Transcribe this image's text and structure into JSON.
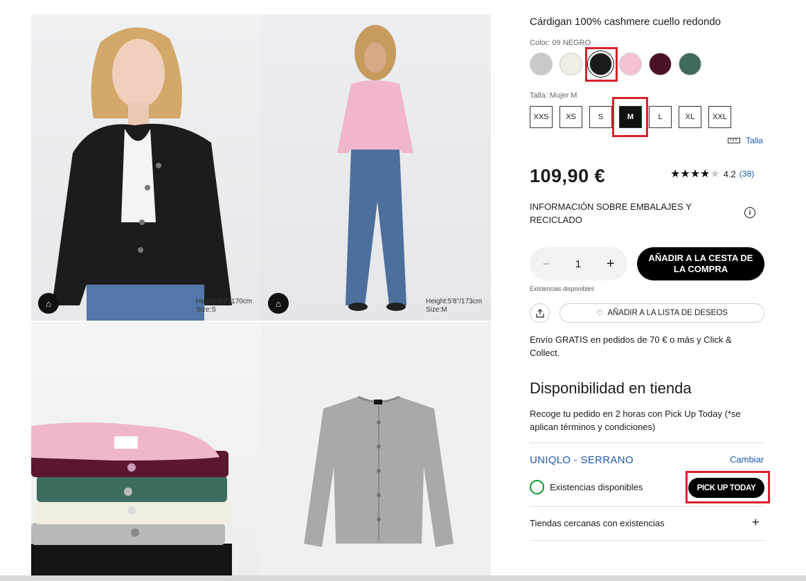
{
  "gallery": {
    "image1_alt": "Model wearing black cardigan",
    "image1_model_info": [
      "Height:5'7\"/170cm",
      "Size:S"
    ],
    "image2_alt": "Model wearing pink cardigan",
    "image2_model_info": [
      "Height:5'8\"/173cm",
      "Size:M"
    ],
    "image3_alt": "Stack of cardigans",
    "image4_alt": "Grey cardigan flat lay",
    "model_icon": "hanger-icon"
  },
  "product": {
    "title": "Cárdigan 100% cashmere cuello redondo",
    "color_label": "Color: 09 NEGRO",
    "size_label": "Talla: Mujer M",
    "price": "109,90 €",
    "rating_value": "4.2",
    "rating_count": "(38)",
    "size_guide": "Talla",
    "packaging_info": "INFORMACIÓN SOBRE EMBALAJES Y RECICLADO"
  },
  "colors": [
    {
      "name": "gris",
      "hex": "#c9c9c9"
    },
    {
      "name": "natural",
      "hex": "#f1ede4"
    },
    {
      "name": "negro",
      "hex": "#1a1a1a"
    },
    {
      "name": "rosa",
      "hex": "#f4c2d3"
    },
    {
      "name": "burdeos",
      "hex": "#4a1028"
    },
    {
      "name": "verde",
      "hex": "#3e6a60"
    }
  ],
  "sizes": [
    "XXS",
    "XS",
    "S",
    "M",
    "L",
    "XL",
    "XXL"
  ],
  "selected_size": "M",
  "cart": {
    "quantity": "1",
    "minus": "−",
    "plus": "+",
    "add_to_cart": "AÑADIR A LA CESTA DE LA COMPRA",
    "stock_note": "Existencias disponibles",
    "wishlist": "AÑADIR A LA LISTA DE DESEOS",
    "shipping": "Envío GRATIS en pedidos de 70 € o más y Click & Collect."
  },
  "store_availability": {
    "heading": "Disponibilidad en tienda",
    "description": "Recoge tu pedido en 2 horas con Pick Up Today (*se aplican términos y condiciones)",
    "store_name": "UNIQLO - SERRANO",
    "change": "Cambiar",
    "stock_status": "Existencias disponibles",
    "pickup_button": "PICK UP TODAY",
    "nearby": "Tiendas cercanas con existencias",
    "nearby_toggle": "+"
  },
  "highlight_color": "#d8202c"
}
